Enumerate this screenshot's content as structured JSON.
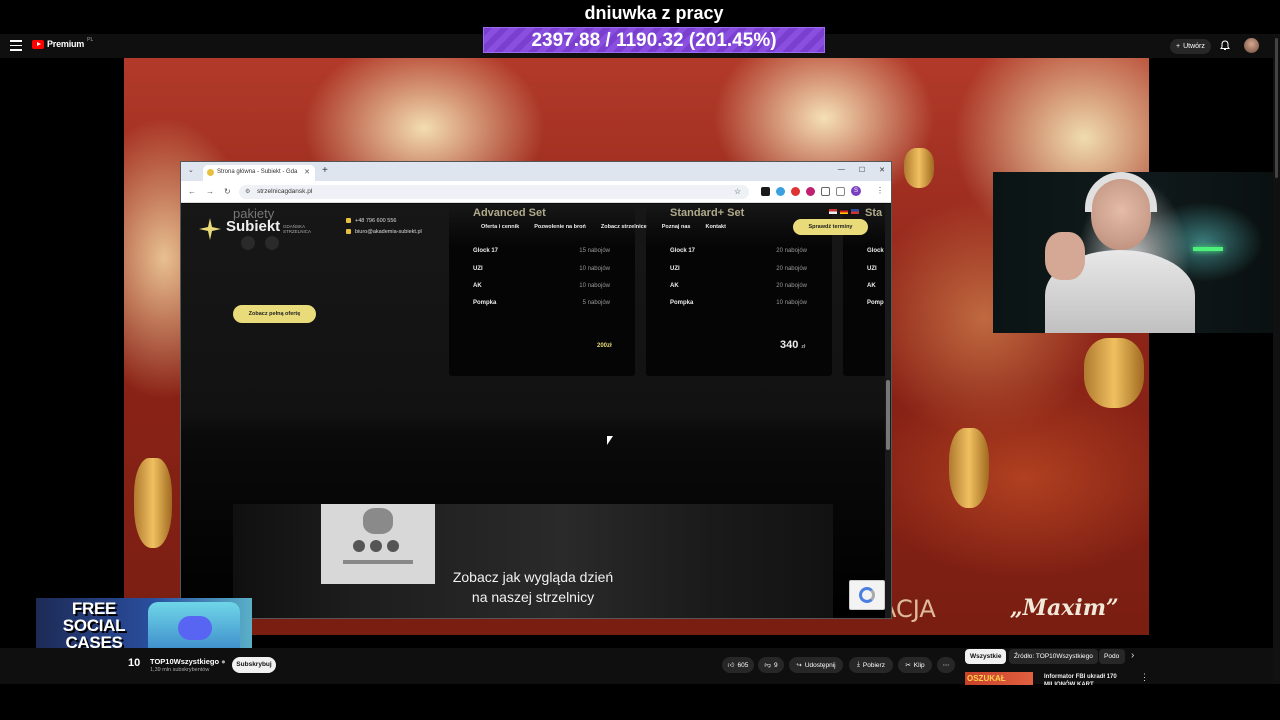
{
  "overlay": {
    "title": "dniuwka z pracy",
    "counter": "2397.88 / 1190.32 (201.45%)",
    "counter_color": "#7b3fd0"
  },
  "youtube": {
    "logo_text": "Premium",
    "logo_suffix": "PL",
    "create_label": "Utwórz",
    "channel_logo": "10",
    "channel_name": "TOP10Wszystkiego",
    "channel_subs": "1,39 mln subskrybentów",
    "subscribe": "Subskrybuj",
    "likes": "605",
    "dislikes": "9",
    "share": "Udostępnij",
    "download": "Pobierz",
    "clip": "Klip",
    "chips": [
      "Wszystkie",
      "Źródło: TOP10Wszystkiego",
      "Podo"
    ],
    "rec_thumb_text": "OSZUKAŁ",
    "rec_title": "Informator FBI ukradł 170 MILIONÓW KART"
  },
  "video": {
    "overlay_text_left": "ACJA",
    "overlay_text_right": "„Maxim”"
  },
  "browser": {
    "tab_title": "Strona główna - Subiekt - Gda",
    "url": "strzelnicagdansk.pl",
    "profile_initial": "S"
  },
  "site": {
    "pakiety": "pakiety",
    "brand": "Subiekt",
    "brand_sub": "GDAŃSKA STRZELNICA",
    "phone": "+48 796 600 556",
    "email": "biuro@akademia-subiekt.pl",
    "nav": [
      "Oferta i cennik",
      "Pozwolenie na broń",
      "Zobacz strzelnice",
      "Poznaj nas",
      "Kontakt"
    ],
    "cta": "Sprawdź terminy",
    "offer_button": "Zobacz pełną ofertę",
    "cards": [
      {
        "title": "Advanced Set",
        "rows": [
          {
            "weapon": "Glock 17",
            "ammo": "15 nabojów"
          },
          {
            "weapon": "UZI",
            "ammo": "10 nabojów"
          },
          {
            "weapon": "AK",
            "ammo": "10 nabojów"
          },
          {
            "weapon": "Pompka",
            "ammo": "5 nabojów"
          }
        ],
        "price": "200zł"
      },
      {
        "title": "Standard+ Set",
        "rows": [
          {
            "weapon": "Glock 17",
            "ammo": "20 nabojów"
          },
          {
            "weapon": "UZI",
            "ammo": "20 nabojów"
          },
          {
            "weapon": "AK",
            "ammo": "20 nabojów"
          },
          {
            "weapon": "Pompka",
            "ammo": "10 nabojów"
          }
        ],
        "price": "340",
        "currency": "zł"
      },
      {
        "title": "Sta",
        "rows": [
          {
            "weapon": "Glock"
          },
          {
            "weapon": "UZI"
          },
          {
            "weapon": "AK"
          },
          {
            "weapon": "Pomp"
          }
        ]
      }
    ],
    "video_caption_1": "Zobacz jak wygląda dzień",
    "video_caption_2": "na naszej strzelnicy"
  },
  "promo": {
    "text": "FREE SOCIAL CASES"
  }
}
